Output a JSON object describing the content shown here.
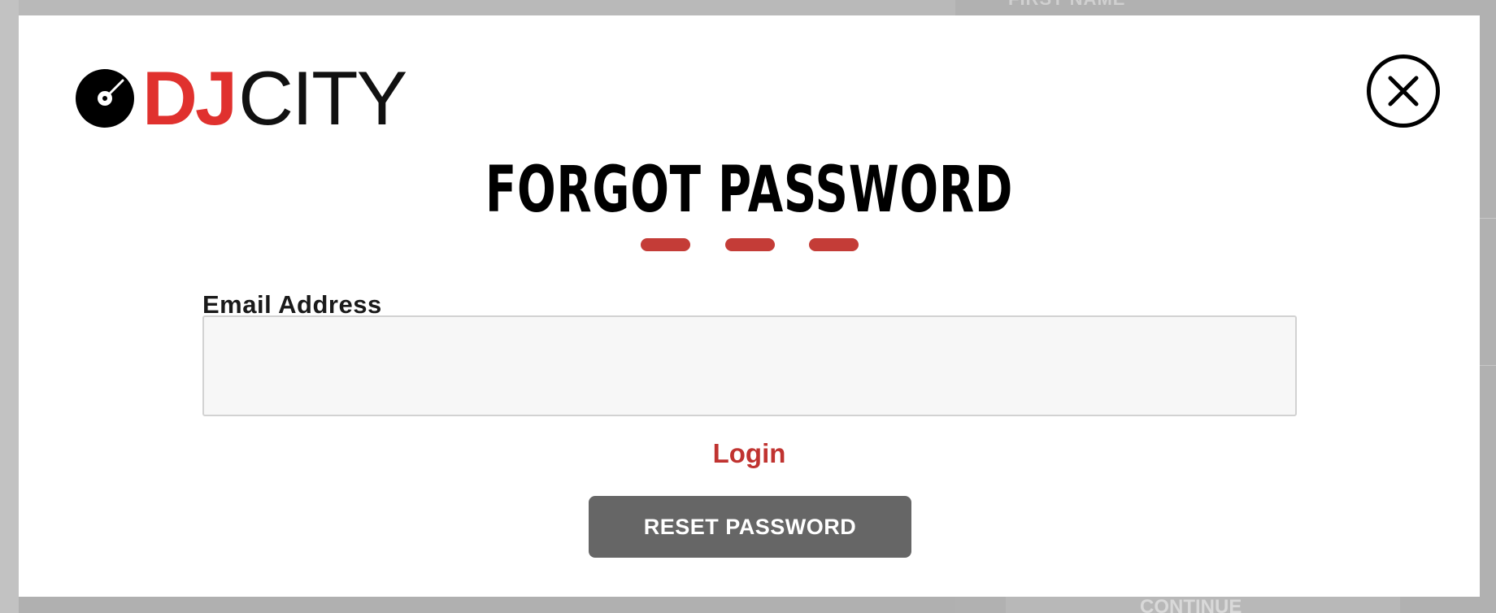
{
  "background": {
    "field_label_partial": "FIRST NAME",
    "continue_label": "CONTINUE"
  },
  "modal": {
    "logo": {
      "icon": "vinyl-disc-icon",
      "text_dj": "DJ",
      "text_city": "CITY",
      "dj_color": "#e0312e"
    },
    "close_icon": "close-icon",
    "title": "FORGOT PASSWORD",
    "divider_color": "#c43c37",
    "email_label": "Email Address",
    "email_value": "",
    "email_placeholder": "",
    "login_link": "Login",
    "reset_button": "RESET PASSWORD",
    "accent_color": "#c03330",
    "button_color": "#666666"
  }
}
